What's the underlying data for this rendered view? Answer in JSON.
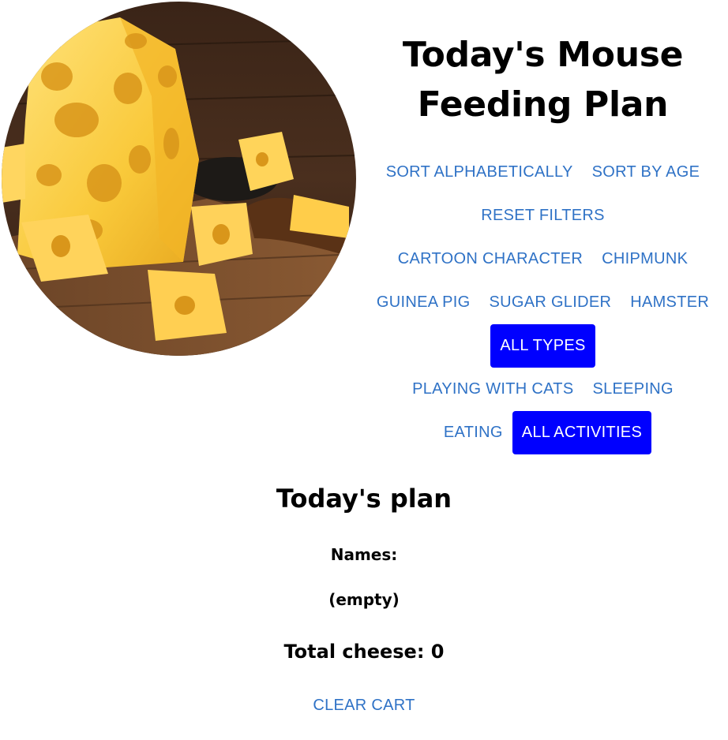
{
  "title_line1": "Today's Mouse",
  "title_line2": "Feeding Plan",
  "image": {
    "description_icon": "cheese-image"
  },
  "sort": {
    "alphabetical": "SORT ALPHABETICALLY",
    "by_age": "SORT BY AGE"
  },
  "reset": "RESET FILTERS",
  "types": {
    "cartoon": "CARTOON CHARACTER",
    "chipmunk": "CHIPMUNK",
    "guinea_pig": "GUINEA PIG",
    "sugar_glider": "SUGAR GLIDER",
    "hamster": "HAMSTER",
    "all": "ALL TYPES"
  },
  "activities": {
    "playing": "PLAYING WITH CATS",
    "sleeping": "SLEEPING",
    "eating": "EATING",
    "all": "ALL ACTIVITIES"
  },
  "plan": {
    "heading": "Today's plan",
    "names_label": "Names:",
    "names_value": "(empty)",
    "total_cheese": "Total cheese: 0",
    "clear": "CLEAR CART"
  },
  "colors": {
    "link": "#2f72c6",
    "active_bg": "#0000ff",
    "active_text": "#ffffff"
  }
}
